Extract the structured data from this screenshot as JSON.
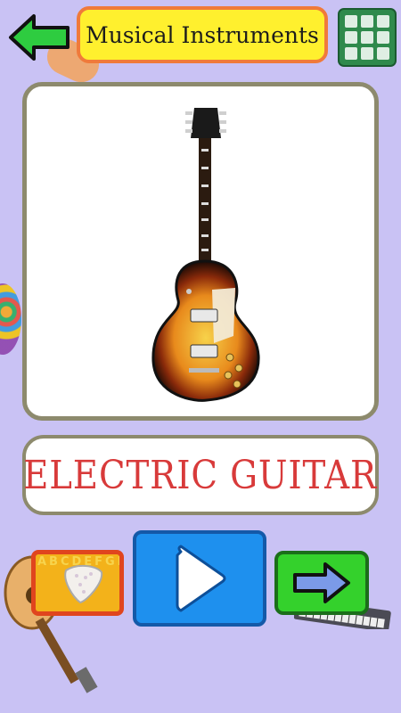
{
  "header": {
    "title": "Musical Instruments",
    "back_icon": "arrow-left-icon",
    "grid_icon": "grid-menu-icon"
  },
  "card": {
    "image": "electric-guitar-image",
    "word": "ELECTRIC GUITAR"
  },
  "controls": {
    "abc_icon": "alphabet-tiles-icon",
    "play_icon": "play-icon",
    "next_icon": "arrow-right-icon",
    "abc_letters": "ABCDEFGHIJKLMNOPQRSTUV"
  },
  "colors": {
    "background": "#c9c2f4",
    "title_bg": "#fff02e",
    "title_border": "#f07a3a",
    "word": "#d83a3a",
    "play": "#1e90ee",
    "next": "#34d12c",
    "back_arrow": "#2ecc40",
    "card_border": "#8d8a6d"
  }
}
